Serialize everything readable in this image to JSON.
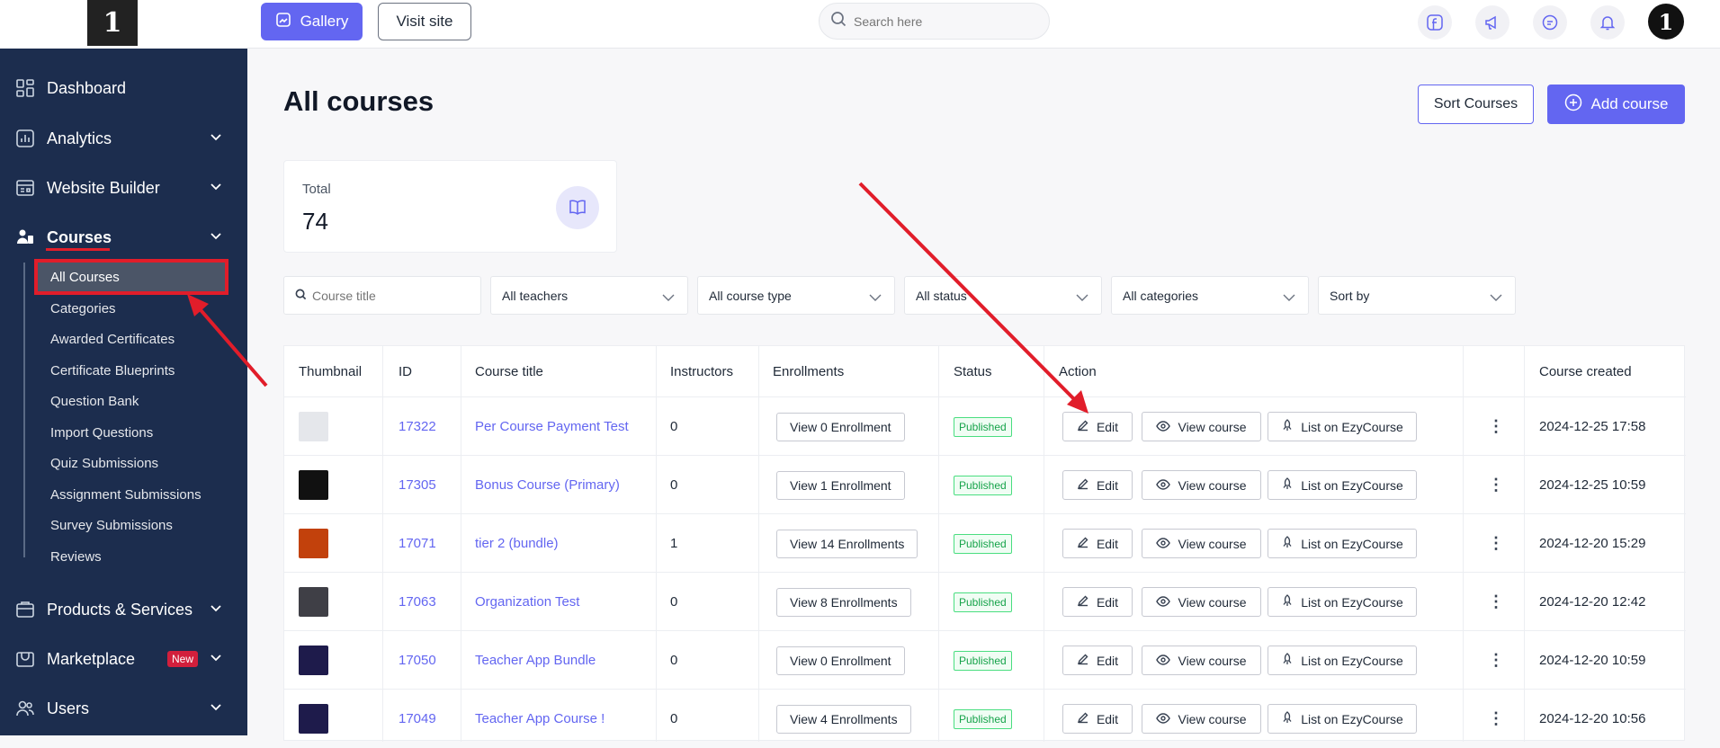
{
  "sidebar": {
    "logo_text": "1",
    "items": [
      {
        "label": "Dashboard",
        "icon": "dashboard-icon"
      },
      {
        "label": "Analytics",
        "icon": "analytics-icon"
      },
      {
        "label": "Website Builder",
        "icon": "website-builder-icon"
      },
      {
        "label": "Courses",
        "icon": "courses-icon"
      },
      {
        "label": "Products & Services",
        "icon": "products-icon"
      },
      {
        "label": "Marketplace",
        "icon": "marketplace-icon",
        "badge": "New"
      },
      {
        "label": "Users",
        "icon": "users-icon"
      }
    ],
    "course_subitems": [
      "All Courses",
      "Categories",
      "Awarded Certificates",
      "Certificate Blueprints",
      "Question Bank",
      "Import Questions",
      "Quiz Submissions",
      "Assignment Submissions",
      "Survey Submissions",
      "Reviews"
    ]
  },
  "topbar": {
    "gallery_label": "Gallery",
    "visit_label": "Visit site",
    "search_placeholder": "Search here",
    "avatar_text": "1"
  },
  "page": {
    "title": "All courses",
    "sort_label": "Sort Courses",
    "add_label": "Add course",
    "total_label": "Total",
    "total_value": "74"
  },
  "filters": {
    "search_placeholder": "Course title",
    "teachers": "All teachers",
    "course_type": "All course type",
    "status": "All status",
    "categories": "All categories",
    "sort": "Sort by"
  },
  "table": {
    "headers": [
      "Thumbnail",
      "ID",
      "Course title",
      "Instructors",
      "Enrollments",
      "Status",
      "Action",
      "Course created"
    ],
    "edit_label": "Edit",
    "view_label": "View course",
    "list_label": "List on EzyCourse",
    "rows": [
      {
        "id": "17322",
        "title": "Per Course Payment Test",
        "instructors": "0",
        "enroll": "View 0 Enrollment",
        "status": "Published",
        "created": "2024-12-25 17:58",
        "thumb": "#e5e7eb"
      },
      {
        "id": "17305",
        "title": "Bonus Course (Primary)",
        "instructors": "0",
        "enroll": "View 1 Enrollment",
        "status": "Published",
        "created": "2024-12-25 10:59",
        "thumb": "#111111"
      },
      {
        "id": "17071",
        "title": "tier 2 (bundle)",
        "instructors": "1",
        "enroll": "View 14 Enrollments",
        "status": "Published",
        "created": "2024-12-20 15:29",
        "thumb": "#c2410c"
      },
      {
        "id": "17063",
        "title": "Organization Test",
        "instructors": "0",
        "enroll": "View 8 Enrollments",
        "status": "Published",
        "created": "2024-12-20 12:42",
        "thumb": "#3f3f46"
      },
      {
        "id": "17050",
        "title": "Teacher App Bundle",
        "instructors": "0",
        "enroll": "View 0 Enrollment",
        "status": "Published",
        "created": "2024-12-20 10:59",
        "thumb": "#1e1b4b"
      },
      {
        "id": "17049",
        "title": "Teacher App Course !",
        "instructors": "0",
        "enroll": "View 4 Enrollments",
        "status": "Published",
        "created": "2024-12-20 10:56",
        "thumb": "#1e1b4b"
      }
    ]
  },
  "colors": {
    "accent": "#6366f1",
    "sidebar": "#1c2d4e",
    "annotation": "#e11d2a"
  }
}
